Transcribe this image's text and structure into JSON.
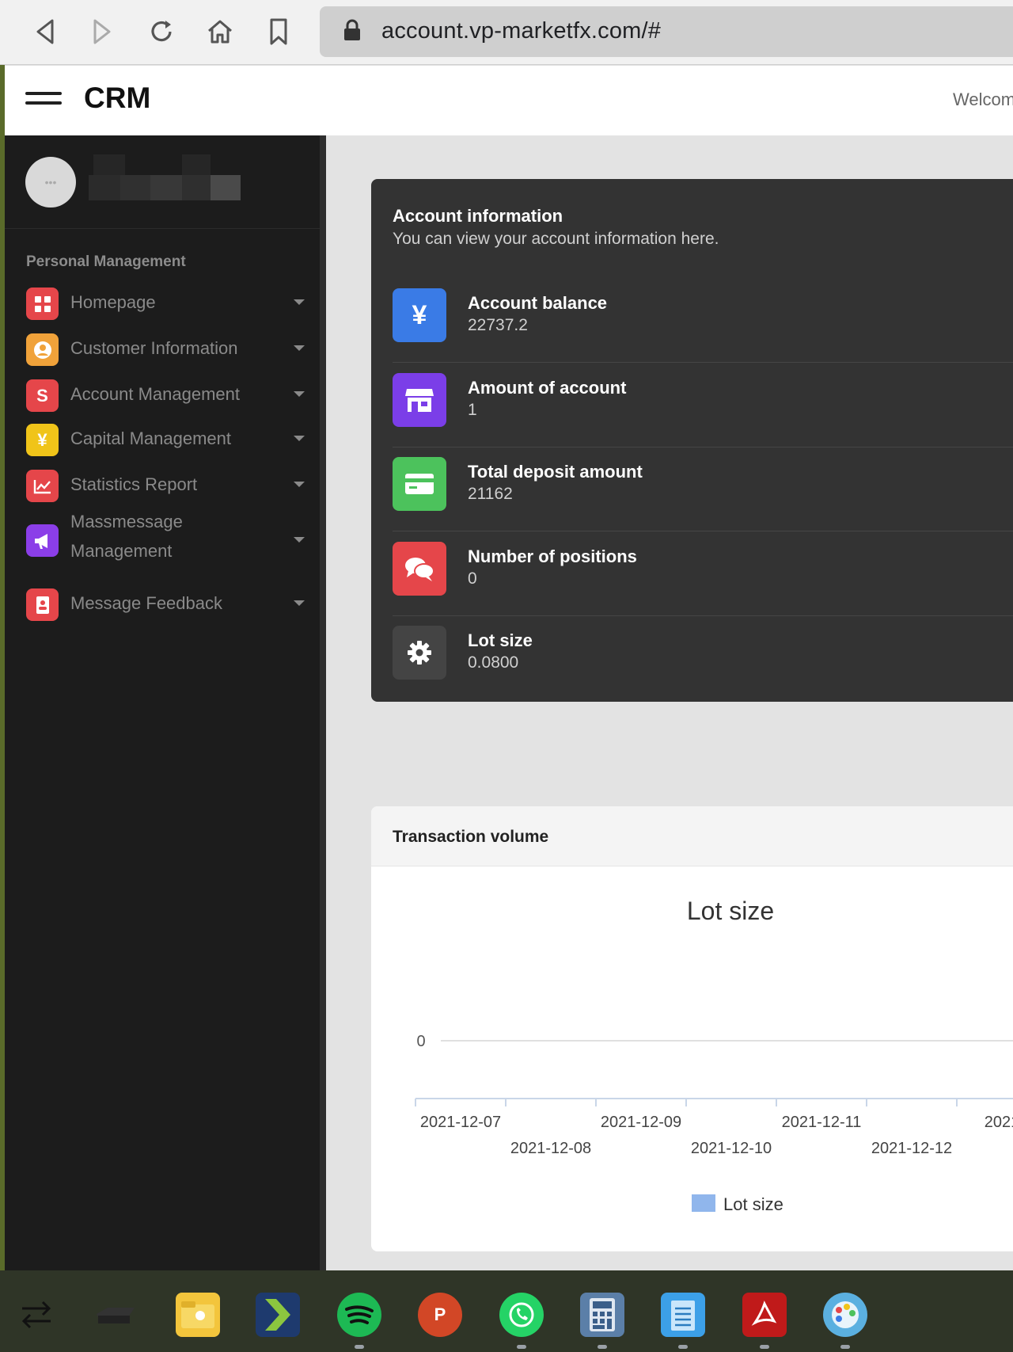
{
  "browser": {
    "url": "account.vp-marketfx.com/#"
  },
  "header": {
    "brand": "CRM",
    "welcome": "Welcome"
  },
  "sidebar": {
    "section_title": "Personal Management",
    "items": [
      {
        "label": "Homepage",
        "icon": "grid-icon",
        "color": "#e5464a"
      },
      {
        "label": "Customer Information",
        "icon": "user-icon",
        "color": "#f0a23a"
      },
      {
        "label": "Account Management",
        "icon": "dollar-icon",
        "color": "#e5464a"
      },
      {
        "label": "Capital Management",
        "icon": "yen-icon",
        "color": "#f0c419"
      },
      {
        "label": "Statistics Report",
        "icon": "chart-icon",
        "color": "#e5464a"
      },
      {
        "label": "Massmessage Management",
        "icon": "megaphone-icon",
        "color": "#8b3ee8"
      },
      {
        "label": "Message Feedback",
        "icon": "contact-icon",
        "color": "#e5464a"
      }
    ]
  },
  "account_info": {
    "title": "Account information",
    "subtitle": "You can view your account information here.",
    "stats": [
      {
        "label": "Account balance",
        "value": "22737.2",
        "icon": "yen-icon",
        "color": "#3a7be6",
        "glyph": "¥"
      },
      {
        "label": "Amount of account",
        "value": "1",
        "icon": "store-icon",
        "color": "#7b3ee8",
        "glyph": "⌂"
      },
      {
        "label": "Total deposit amount",
        "value": "21162",
        "icon": "card-icon",
        "color": "#4cc25c",
        "glyph": "▭"
      },
      {
        "label": "Number of positions",
        "value": "0",
        "icon": "chat-icon",
        "color": "#e5464a",
        "glyph": "✉"
      },
      {
        "label": "Lot size",
        "value": "0.0800",
        "icon": "gear-icon",
        "color": "#444444",
        "glyph": "⚙"
      }
    ]
  },
  "transaction_card": {
    "title": "Transaction volume"
  },
  "chart_data": {
    "type": "bar",
    "title": "Lot size",
    "categories": [
      "2021-12-07",
      "2021-12-08",
      "2021-12-09",
      "2021-12-10",
      "2021-12-11",
      "2021-12-12",
      "2021"
    ],
    "series": [
      {
        "name": "Lot size",
        "values": [
          0,
          0,
          0,
          0,
          0,
          0,
          0
        ],
        "color": "#90b6ec"
      }
    ],
    "y_ticks": [
      "0"
    ],
    "legend": "bottom-center",
    "grid": true
  }
}
